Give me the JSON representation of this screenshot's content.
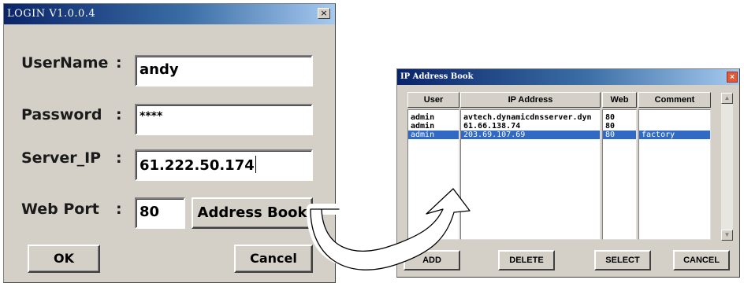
{
  "login": {
    "title": "LOGIN  V1.0.0.4",
    "close": "×",
    "username_label": "UserName",
    "password_label": "Password",
    "server_label": "Server_IP",
    "port_label": "Web Port",
    "colon": ":",
    "username_value": "andy",
    "password_value": "****",
    "server_value": "61.222.50.174",
    "port_value": "80",
    "address_book_button": "Address Book",
    "ok_button": "OK",
    "cancel_button": "Cancel"
  },
  "address_book": {
    "title": "IP Address Book",
    "close": "×",
    "columns": [
      "User",
      "IP Address",
      "Web",
      "Comment"
    ],
    "rows": [
      {
        "user": "admin",
        "ip": "avtech.dynamicdnsserver.dyn",
        "web": "80",
        "comment": "",
        "selected": false
      },
      {
        "user": "admin",
        "ip": "61.66.138.74",
        "web": "80",
        "comment": "",
        "selected": false
      },
      {
        "user": "admin",
        "ip": "203.69.107.69",
        "web": "80",
        "comment": "factory",
        "selected": true
      }
    ],
    "buttons": {
      "add": "ADD",
      "delete": "DELETE",
      "select": "SELECT",
      "cancel": "CANCEL"
    },
    "scroll_up": "▲",
    "scroll_down": "▼"
  }
}
